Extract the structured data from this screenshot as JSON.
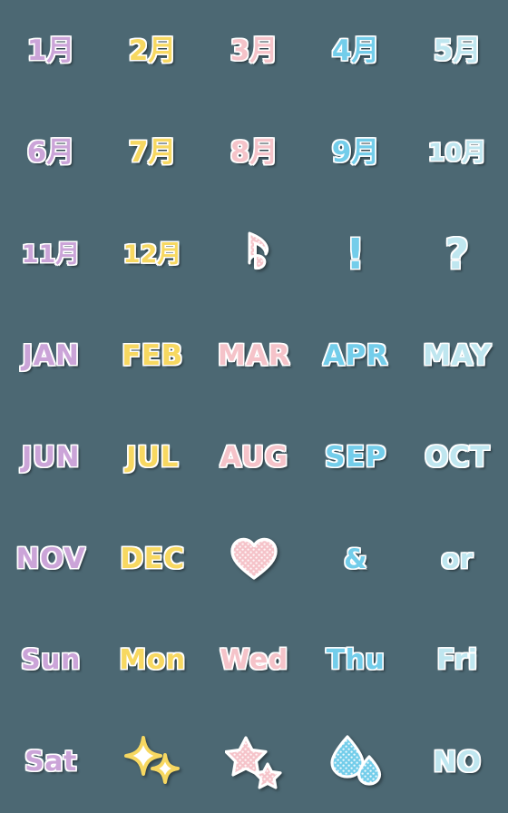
{
  "sheet": {
    "title": "Pastel calendar emoji sticker sheet",
    "background_color": "#4c6873",
    "columns": 5,
    "rows": 8,
    "palette": {
      "lilac": "#cba4d8",
      "yellow": "#f7d861",
      "pink": "#f5c3c9",
      "blue": "#73cdea",
      "pale_blue": "#bfe6ef",
      "outline": "#ffffff",
      "shadow": "#1a2429",
      "background": "#4c6873"
    },
    "items": [
      {
        "id": "jan-jp",
        "label": "1月",
        "kind": "text",
        "style": "jp",
        "color": "lilac"
      },
      {
        "id": "feb-jp",
        "label": "2月",
        "kind": "text",
        "style": "jp",
        "color": "yellow"
      },
      {
        "id": "mar-jp",
        "label": "3月",
        "kind": "text",
        "style": "jp",
        "color": "pink"
      },
      {
        "id": "apr-jp",
        "label": "4月",
        "kind": "text",
        "style": "jp",
        "color": "blue"
      },
      {
        "id": "may-jp",
        "label": "5月",
        "kind": "text",
        "style": "jp",
        "color": "pale_blue"
      },
      {
        "id": "jun-jp",
        "label": "6月",
        "kind": "text",
        "style": "jp",
        "color": "lilac"
      },
      {
        "id": "jul-jp",
        "label": "7月",
        "kind": "text",
        "style": "jp",
        "color": "yellow"
      },
      {
        "id": "aug-jp",
        "label": "8月",
        "kind": "text",
        "style": "jp",
        "color": "pink"
      },
      {
        "id": "sep-jp",
        "label": "9月",
        "kind": "text",
        "style": "jp",
        "color": "blue"
      },
      {
        "id": "oct-jp",
        "label": "10月",
        "kind": "text",
        "style": "jp-narrow",
        "color": "pale_blue"
      },
      {
        "id": "nov-jp",
        "label": "11月",
        "kind": "text",
        "style": "jp-narrow",
        "color": "lilac"
      },
      {
        "id": "dec-jp",
        "label": "12月",
        "kind": "text",
        "style": "jp-narrow",
        "color": "yellow"
      },
      {
        "id": "music-note",
        "label": "♪",
        "kind": "graphic",
        "graphic": "music-note",
        "color": "pink"
      },
      {
        "id": "exclamation",
        "label": "!",
        "kind": "text",
        "style": "symbol",
        "color": "blue"
      },
      {
        "id": "question",
        "label": "?",
        "kind": "text",
        "style": "symbol",
        "color": "pale_blue"
      },
      {
        "id": "jan-en",
        "label": "JAN",
        "kind": "text",
        "style": "month",
        "color": "lilac"
      },
      {
        "id": "feb-en",
        "label": "FEB",
        "kind": "text",
        "style": "month",
        "color": "yellow"
      },
      {
        "id": "mar-en",
        "label": "MAR",
        "kind": "text",
        "style": "month",
        "color": "pink"
      },
      {
        "id": "apr-en",
        "label": "APR",
        "kind": "text",
        "style": "month",
        "color": "blue"
      },
      {
        "id": "may-en",
        "label": "MAY",
        "kind": "text",
        "style": "month",
        "color": "pale_blue"
      },
      {
        "id": "jun-en",
        "label": "JUN",
        "kind": "text",
        "style": "month",
        "color": "lilac"
      },
      {
        "id": "jul-en",
        "label": "JUL",
        "kind": "text",
        "style": "month",
        "color": "yellow"
      },
      {
        "id": "aug-en",
        "label": "AUG",
        "kind": "text",
        "style": "month",
        "color": "pink"
      },
      {
        "id": "sep-en",
        "label": "SEP",
        "kind": "text",
        "style": "month",
        "color": "blue"
      },
      {
        "id": "oct-en",
        "label": "OCT",
        "kind": "text",
        "style": "month",
        "color": "pale_blue"
      },
      {
        "id": "nov-en",
        "label": "NOV",
        "kind": "text",
        "style": "month",
        "color": "lilac"
      },
      {
        "id": "dec-en",
        "label": "DEC",
        "kind": "text",
        "style": "month",
        "color": "yellow"
      },
      {
        "id": "heart",
        "label": "heart",
        "kind": "graphic",
        "graphic": "heart",
        "color": "pink"
      },
      {
        "id": "ampersand",
        "label": "&",
        "kind": "text",
        "style": "word",
        "color": "blue"
      },
      {
        "id": "or",
        "label": "or",
        "kind": "text",
        "style": "word",
        "color": "pale_blue"
      },
      {
        "id": "sun",
        "label": "Sun",
        "kind": "text",
        "style": "day",
        "color": "lilac"
      },
      {
        "id": "mon",
        "label": "Mon",
        "kind": "text",
        "style": "day",
        "color": "yellow"
      },
      {
        "id": "wed",
        "label": "Wed",
        "kind": "text",
        "style": "day",
        "color": "pink"
      },
      {
        "id": "thu",
        "label": "Thu",
        "kind": "text",
        "style": "day",
        "color": "blue"
      },
      {
        "id": "fri",
        "label": "Fri",
        "kind": "text",
        "style": "day",
        "color": "pale_blue"
      },
      {
        "id": "sat",
        "label": "Sat",
        "kind": "text",
        "style": "day",
        "color": "lilac"
      },
      {
        "id": "sparkles",
        "label": "sparkles",
        "kind": "graphic",
        "graphic": "sparkles",
        "color": "yellow"
      },
      {
        "id": "stars",
        "label": "stars",
        "kind": "graphic",
        "graphic": "stars",
        "color": "pink"
      },
      {
        "id": "droplets",
        "label": "droplets",
        "kind": "graphic",
        "graphic": "droplets",
        "color": "blue"
      },
      {
        "id": "no",
        "label": "NO",
        "kind": "text",
        "style": "month",
        "color": "pale_blue"
      }
    ]
  }
}
